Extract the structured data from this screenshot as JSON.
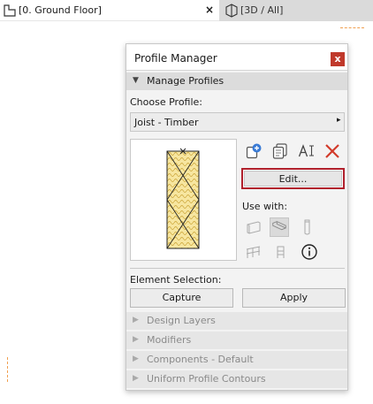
{
  "tabs": [
    {
      "label": "[0. Ground Floor]",
      "close": "×",
      "icon": "floor-plan-icon"
    },
    {
      "label": "[3D / All]",
      "icon": "3d-view-icon"
    }
  ],
  "panel": {
    "title": "Profile Manager",
    "close": "x",
    "manage_section": "Manage Profiles",
    "choose_label": "Choose Profile:",
    "selected_profile": "Joist - Timber",
    "chevron": "▸",
    "tools": [
      "new-profile-icon",
      "duplicate-profile-icon",
      "rename-profile-icon",
      "delete-profile-icon"
    ],
    "edit_label": "Edit...",
    "use_with_label": "Use with:",
    "use_with_items": [
      "wall-icon",
      "beam-icon",
      "column-icon",
      "railing-icon",
      "handrail-icon",
      "info-icon"
    ],
    "element_selection_label": "Element Selection:",
    "capture_label": "Capture",
    "apply_label": "Apply",
    "collapsed_sections": [
      "Design Layers",
      "Modifiers",
      "Components - Default",
      "Uniform Profile Contours"
    ],
    "colors": {
      "accent": "#b0202c",
      "close_bg": "#c0392b",
      "delete": "#d23a2a",
      "hatch_fill": "#f7e6a0",
      "hatch_line": "#c8a030"
    }
  }
}
